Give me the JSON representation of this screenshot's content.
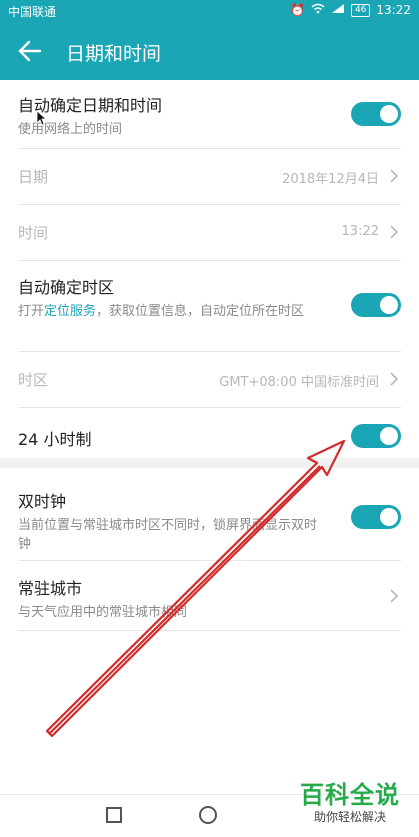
{
  "status_bar": {
    "carrier": "中国联通",
    "battery": "46",
    "time": "13:22"
  },
  "app_bar": {
    "title": "日期和时间"
  },
  "settings": {
    "auto_datetime": {
      "title": "自动确定日期和时间",
      "subtitle": "使用网络上的时间",
      "enabled": true
    },
    "date": {
      "label": "日期",
      "value": "2018年12月4日"
    },
    "time": {
      "label": "时间",
      "value": "13:22"
    },
    "auto_timezone": {
      "title": "自动确定时区",
      "subtitle_prefix": "打开",
      "subtitle_link": "定位服务",
      "subtitle_suffix": "，获取位置信息，自动定位所在时区",
      "enabled": true
    },
    "timezone": {
      "label": "时区",
      "value": "GMT+08:00 中国标准时间"
    },
    "hour24": {
      "title": "24 小时制",
      "enabled": true
    },
    "dual_clock": {
      "title": "双时钟",
      "subtitle": "当前位置与常驻城市时区不同时，锁屏界面显示双时钟",
      "enabled": true
    },
    "home_city": {
      "title": "常驻城市",
      "subtitle": "与天气应用中的常驻城市相同"
    }
  },
  "watermark": {
    "title": "百科全说",
    "subtitle": "助你轻松解决"
  },
  "colors": {
    "accent": "#1ba6b6",
    "annotation_arrow": "#d42a2a"
  }
}
